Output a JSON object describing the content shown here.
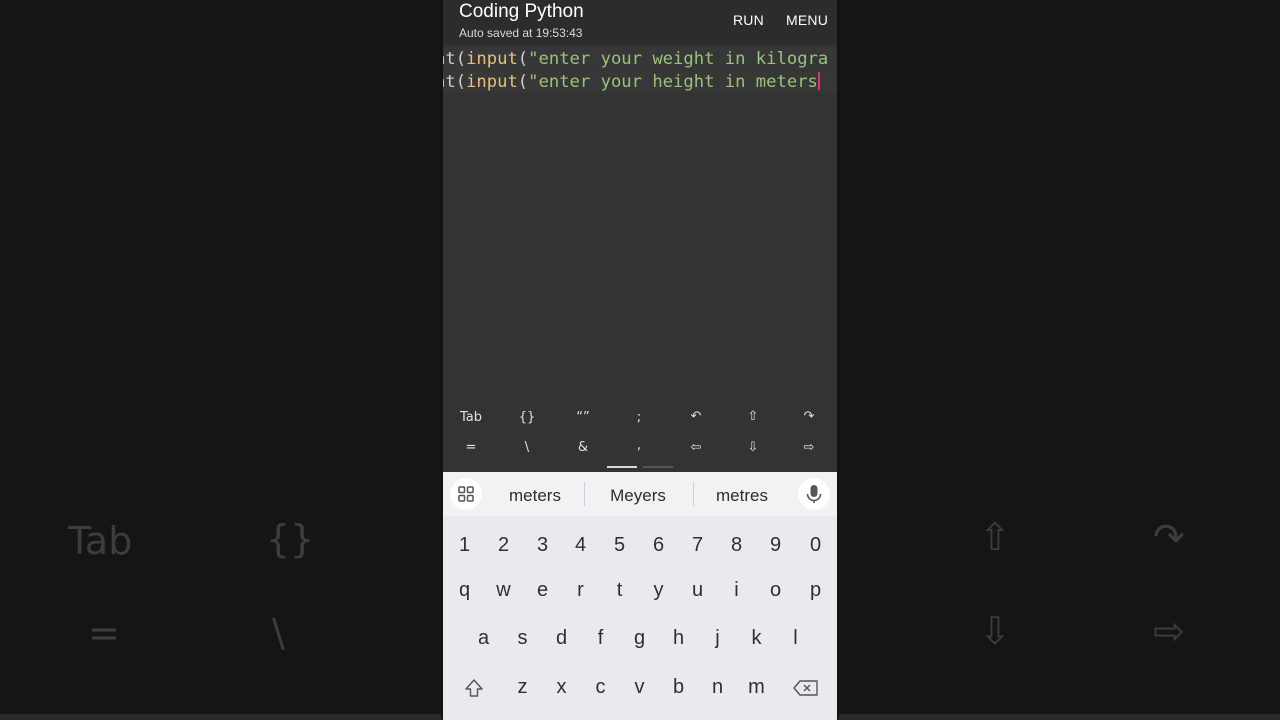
{
  "app": {
    "title": "Coding Python",
    "subtitle": "Auto saved at 19:53:43",
    "run_label": "RUN",
    "menu_label": "MENU"
  },
  "code": {
    "line1": {
      "prefix": "at(",
      "fn": "input",
      "paren": "(",
      "str": "\"enter your weight in kilogra"
    },
    "line2": {
      "prefix": "at(",
      "fn": "input",
      "paren": "(",
      "str": "\"enter your height in meters"
    }
  },
  "symbol_bar": {
    "row1": [
      "Tab",
      "{}",
      "“”",
      ";",
      "↶",
      "⇧",
      "↷"
    ],
    "row2": [
      "=",
      "\\",
      "&",
      ",",
      "⇦",
      "⇩",
      "⇨"
    ]
  },
  "suggestions": [
    "meters",
    "Meyers",
    "metres"
  ],
  "keyboard": {
    "numbers": [
      "1",
      "2",
      "3",
      "4",
      "5",
      "6",
      "7",
      "8",
      "9",
      "0"
    ],
    "row1": [
      "q",
      "w",
      "e",
      "r",
      "t",
      "y",
      "u",
      "i",
      "o",
      "p"
    ],
    "row2": [
      "a",
      "s",
      "d",
      "f",
      "g",
      "h",
      "j",
      "k",
      "l"
    ],
    "row3": [
      "z",
      "x",
      "c",
      "v",
      "b",
      "n",
      "m"
    ]
  },
  "background_ghost": {
    "tab": "Tab",
    "braces": "{}",
    "equals": "=",
    "backslash": "\\",
    "up": "⇧",
    "redo": "↷",
    "down": "⇩",
    "right": "⇨"
  },
  "colors": {
    "accent_caret": "#e8336a",
    "string": "#98c379",
    "function": "#e6c07b",
    "app_bar": "#2c2c2c",
    "editor_bg": "#333333",
    "keyboard_bg": "#e9eaee"
  }
}
